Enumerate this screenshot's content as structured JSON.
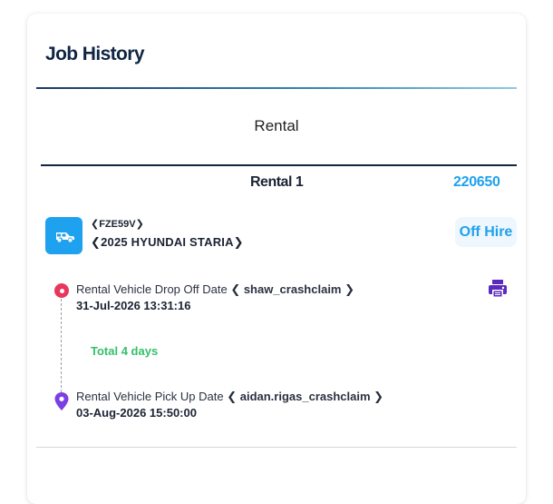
{
  "header": {
    "title": "Job History"
  },
  "tabs": [
    {
      "label": "Rental"
    }
  ],
  "rental": {
    "name": "Rental 1",
    "id": "220650",
    "vehicle": {
      "plate": "❮FZE59V❯",
      "model": "❮2025 HYUNDAI STARIA❯",
      "icon": "car-icon"
    },
    "status": "Off Hire",
    "timeline": {
      "drop_off": {
        "label": "Rental Vehicle Drop Off Date",
        "user": "❮ shaw_crashclaim ❯",
        "date": "31-Jul-2026 13:31:16"
      },
      "total": "Total 4 days",
      "pick_up": {
        "label": "Rental Vehicle Pick Up Date",
        "user": "❮ aidan.rigas_crashclaim ❯",
        "date": "03-Aug-2026 15:50:00"
      }
    }
  },
  "colors": {
    "accent": "#1ea1ef",
    "navy": "#0f2544",
    "start_dot": "#e8375b",
    "pin": "#7b3fe4",
    "total": "#34c06a"
  }
}
